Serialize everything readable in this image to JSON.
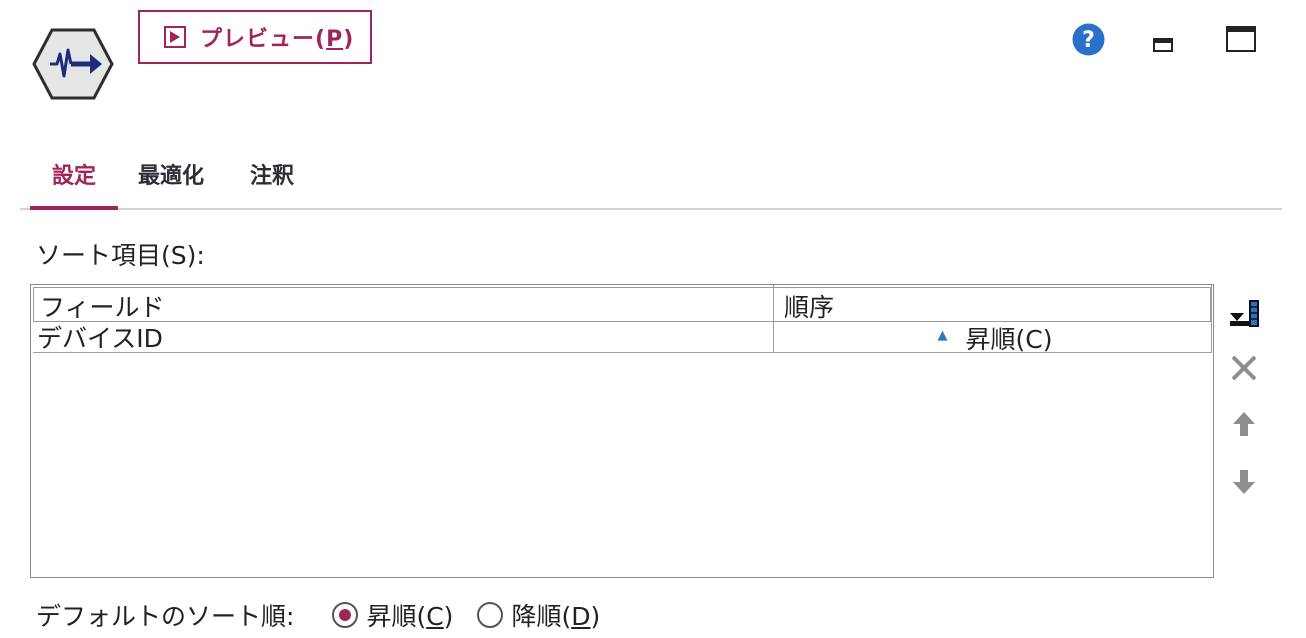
{
  "toolbar": {
    "preview_label": "プレビュー(",
    "preview_mnemonic": "P",
    "preview_close": ")"
  },
  "tabs": [
    {
      "label": "設定",
      "active": true
    },
    {
      "label": "最適化",
      "active": false
    },
    {
      "label": "注釈",
      "active": false
    }
  ],
  "settings": {
    "sort_items_label": "ソート項目(S):",
    "table": {
      "columns": [
        "フィールド",
        "順序"
      ],
      "rows": [
        {
          "field": "デバイスID",
          "order": "昇順(C)"
        }
      ]
    },
    "default_sort": {
      "caption": "デフォルトのソート順:",
      "options": [
        {
          "pre": "昇順(",
          "mnemonic": "C",
          "post": ")",
          "selected": true
        },
        {
          "pre": "降順(",
          "mnemonic": "D",
          "post": ")",
          "selected": false
        }
      ]
    }
  },
  "icons": {
    "node": "sort-node-icon",
    "help": "help-icon",
    "minimize": "minimize-icon",
    "maximize": "maximize-icon",
    "side_buttons": [
      "add-field-icon",
      "delete-icon",
      "move-up-icon",
      "move-down-icon"
    ]
  },
  "colors": {
    "accent": "#a2245d",
    "help_blue": "#2a6fc9",
    "node_navy": "#1f2c7a",
    "ascending_marker": "#2b7bb9"
  }
}
